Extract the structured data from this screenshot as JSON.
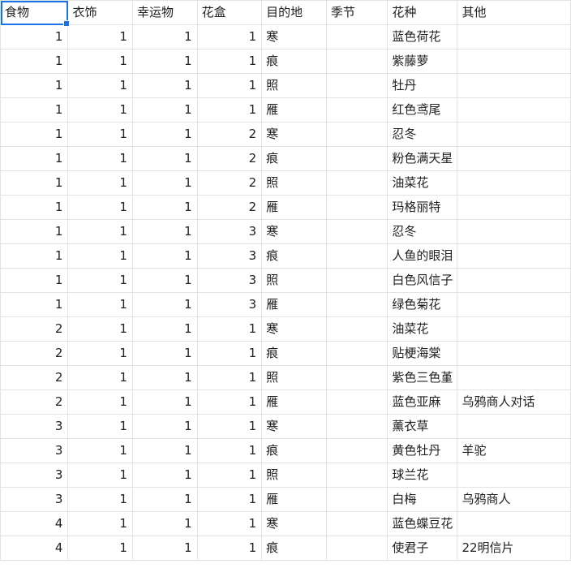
{
  "columns": [
    "食物",
    "衣饰",
    "幸运物",
    "花盒",
    "目的地",
    "季节",
    "花种",
    "其他"
  ],
  "rows": [
    {
      "food": "1",
      "clothing": "1",
      "lucky": "1",
      "box": "1",
      "dest": "寒",
      "season": "",
      "flower": "蓝色荷花",
      "other": ""
    },
    {
      "food": "1",
      "clothing": "1",
      "lucky": "1",
      "box": "1",
      "dest": "痕",
      "season": "",
      "flower": "紫藤萝",
      "other": ""
    },
    {
      "food": "1",
      "clothing": "1",
      "lucky": "1",
      "box": "1",
      "dest": "照",
      "season": "",
      "flower": "牡丹",
      "other": ""
    },
    {
      "food": "1",
      "clothing": "1",
      "lucky": "1",
      "box": "1",
      "dest": "雁",
      "season": "",
      "flower": "红色鸢尾",
      "other": ""
    },
    {
      "food": "1",
      "clothing": "1",
      "lucky": "1",
      "box": "2",
      "dest": "寒",
      "season": "",
      "flower": "忍冬",
      "other": ""
    },
    {
      "food": "1",
      "clothing": "1",
      "lucky": "1",
      "box": "2",
      "dest": "痕",
      "season": "",
      "flower": "粉色满天星",
      "other": ""
    },
    {
      "food": "1",
      "clothing": "1",
      "lucky": "1",
      "box": "2",
      "dest": "照",
      "season": "",
      "flower": "油菜花",
      "other": ""
    },
    {
      "food": "1",
      "clothing": "1",
      "lucky": "1",
      "box": "2",
      "dest": "雁",
      "season": "",
      "flower": "玛格丽特",
      "other": ""
    },
    {
      "food": "1",
      "clothing": "1",
      "lucky": "1",
      "box": "3",
      "dest": "寒",
      "season": "",
      "flower": "忍冬",
      "other": ""
    },
    {
      "food": "1",
      "clothing": "1",
      "lucky": "1",
      "box": "3",
      "dest": "痕",
      "season": "",
      "flower": "人鱼的眼泪",
      "other": ""
    },
    {
      "food": "1",
      "clothing": "1",
      "lucky": "1",
      "box": "3",
      "dest": "照",
      "season": "",
      "flower": "白色风信子",
      "other": ""
    },
    {
      "food": "1",
      "clothing": "1",
      "lucky": "1",
      "box": "3",
      "dest": "雁",
      "season": "",
      "flower": "绿色菊花",
      "other": ""
    },
    {
      "food": "2",
      "clothing": "1",
      "lucky": "1",
      "box": "1",
      "dest": "寒",
      "season": "",
      "flower": "油菜花",
      "other": ""
    },
    {
      "food": "2",
      "clothing": "1",
      "lucky": "1",
      "box": "1",
      "dest": "痕",
      "season": "",
      "flower": "贴梗海棠",
      "other": ""
    },
    {
      "food": "2",
      "clothing": "1",
      "lucky": "1",
      "box": "1",
      "dest": "照",
      "season": "",
      "flower": "紫色三色堇",
      "other": ""
    },
    {
      "food": "2",
      "clothing": "1",
      "lucky": "1",
      "box": "1",
      "dest": "雁",
      "season": "",
      "flower": "蓝色亚麻",
      "other": "乌鸦商人对话"
    },
    {
      "food": "3",
      "clothing": "1",
      "lucky": "1",
      "box": "1",
      "dest": "寒",
      "season": "",
      "flower": "薰衣草",
      "other": ""
    },
    {
      "food": "3",
      "clothing": "1",
      "lucky": "1",
      "box": "1",
      "dest": "痕",
      "season": "",
      "flower": "黄色牡丹",
      "other": "羊驼"
    },
    {
      "food": "3",
      "clothing": "1",
      "lucky": "1",
      "box": "1",
      "dest": "照",
      "season": "",
      "flower": "球兰花",
      "other": ""
    },
    {
      "food": "3",
      "clothing": "1",
      "lucky": "1",
      "box": "1",
      "dest": "雁",
      "season": "",
      "flower": "白梅",
      "other": "乌鸦商人"
    },
    {
      "food": "4",
      "clothing": "1",
      "lucky": "1",
      "box": "1",
      "dest": "寒",
      "season": "",
      "flower": "蓝色蝶豆花",
      "other": ""
    },
    {
      "food": "4",
      "clothing": "1",
      "lucky": "1",
      "box": "1",
      "dest": "痕",
      "season": "",
      "flower": "使君子",
      "other": "22明信片"
    }
  ],
  "selected_cell": "食物"
}
